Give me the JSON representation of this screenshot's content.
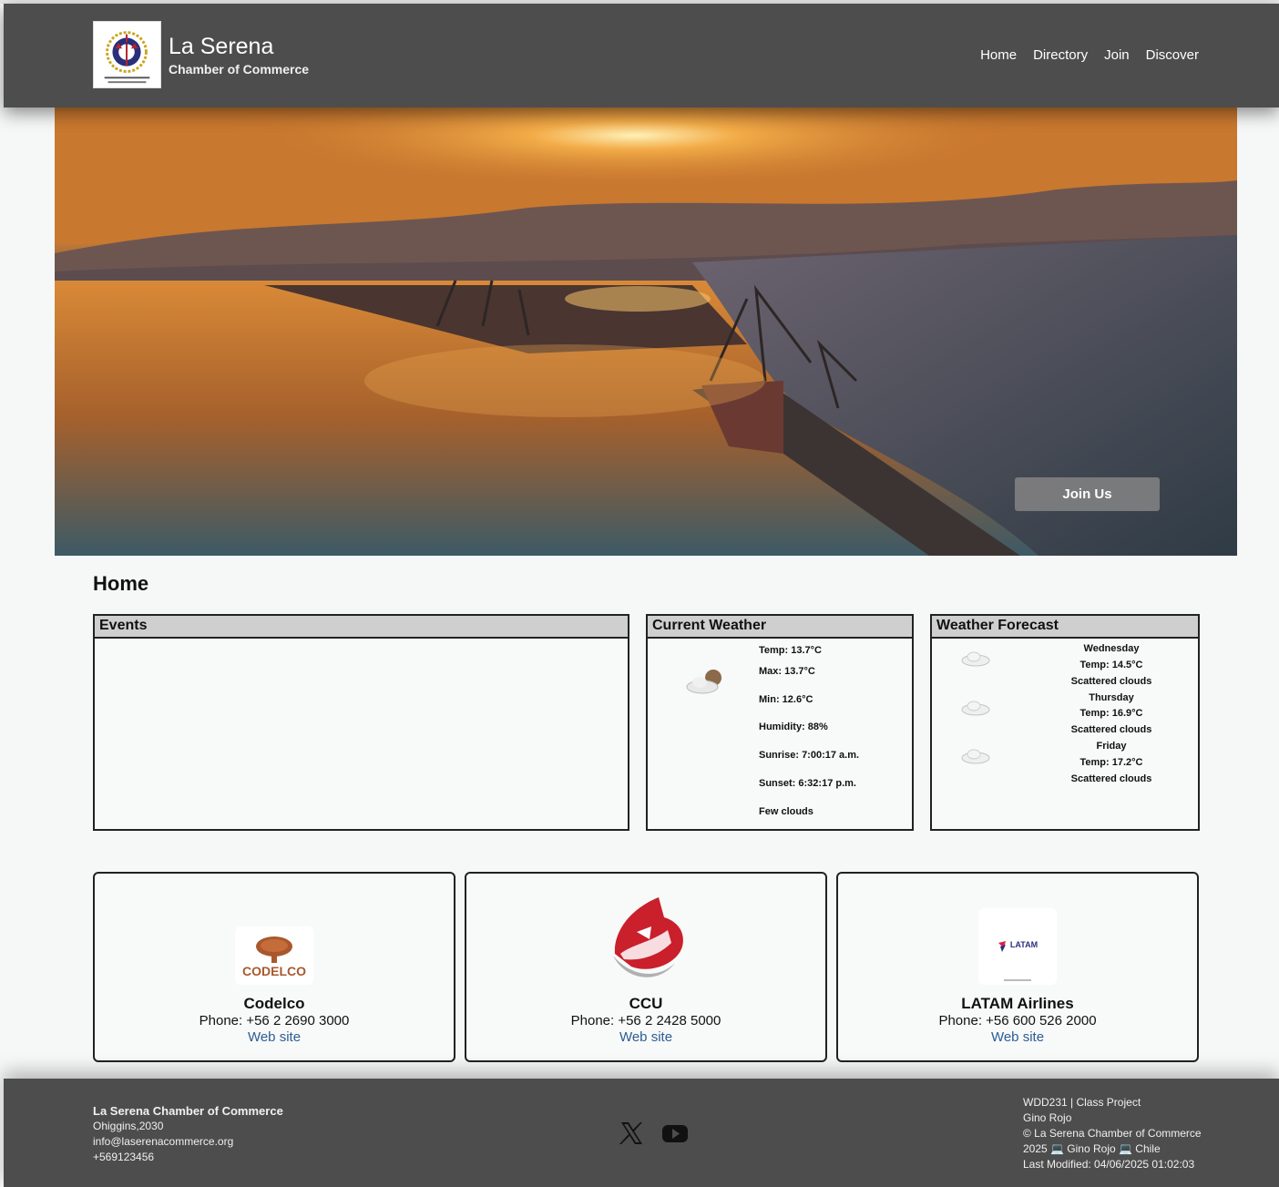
{
  "header": {
    "brand_name": "La Serena",
    "brand_sub": "Chamber of Commerce",
    "nav": [
      "Home",
      "Directory",
      "Join",
      "Discover"
    ]
  },
  "hero": {
    "join_label": "Join Us"
  },
  "page_title": "Home",
  "events": {
    "title": "Events"
  },
  "weather": {
    "title": "Current Weather",
    "icon": "few-clouds-icon",
    "temp": "Temp: 13.7°C",
    "max": "Max: 13.7°C",
    "min": "Min: 12.6°C",
    "humidity": "Humidity: 88%",
    "sunrise": "Sunrise: 7:00:17 a.m.",
    "sunset": "Sunset: 6:32:17 p.m.",
    "description": "Few clouds"
  },
  "forecast": {
    "title": "Weather Forecast",
    "days": [
      {
        "day": "Wednesday",
        "temp": "Temp: 14.5°C",
        "desc": "Scattered clouds",
        "icon": "cloud-icon"
      },
      {
        "day": "Thursday",
        "temp": "Temp: 16.9°C",
        "desc": "Scattered clouds",
        "icon": "cloud-icon"
      },
      {
        "day": "Friday",
        "temp": "Temp: 17.2°C",
        "desc": "Scattered clouds",
        "icon": "cloud-icon"
      }
    ]
  },
  "businesses": [
    {
      "name": "Codelco",
      "phone": "Phone: +56 2 2690 3000",
      "link": "Web site",
      "logo_text": "CODELCO"
    },
    {
      "name": "CCU",
      "phone": "Phone: +56 2 2428 5000",
      "link": "Web site"
    },
    {
      "name": "LATAM Airlines",
      "phone": "Phone: +56 600 526 2000",
      "link": "Web site",
      "logo_text": "LATAM"
    }
  ],
  "footer": {
    "org": "La Serena Chamber of Commerce",
    "address": "Ohiggins,2030",
    "email": "info@laserenacommerce.org",
    "phone": "+569123456",
    "social": [
      "x-icon",
      "youtube-icon"
    ],
    "course": "WDD231 | Class Project",
    "author": "Gino Rojo",
    "copyright": "© La Serena Chamber of Commerce",
    "copyright2": "2025 💻 Gino Rojo 💻 Chile",
    "modified": "Last Modified: 04/06/2025 01:02:03"
  },
  "colors": {
    "header_bg": "#4d4d4d",
    "link": "#2b5d93",
    "card_head": "#cfcfcf"
  }
}
